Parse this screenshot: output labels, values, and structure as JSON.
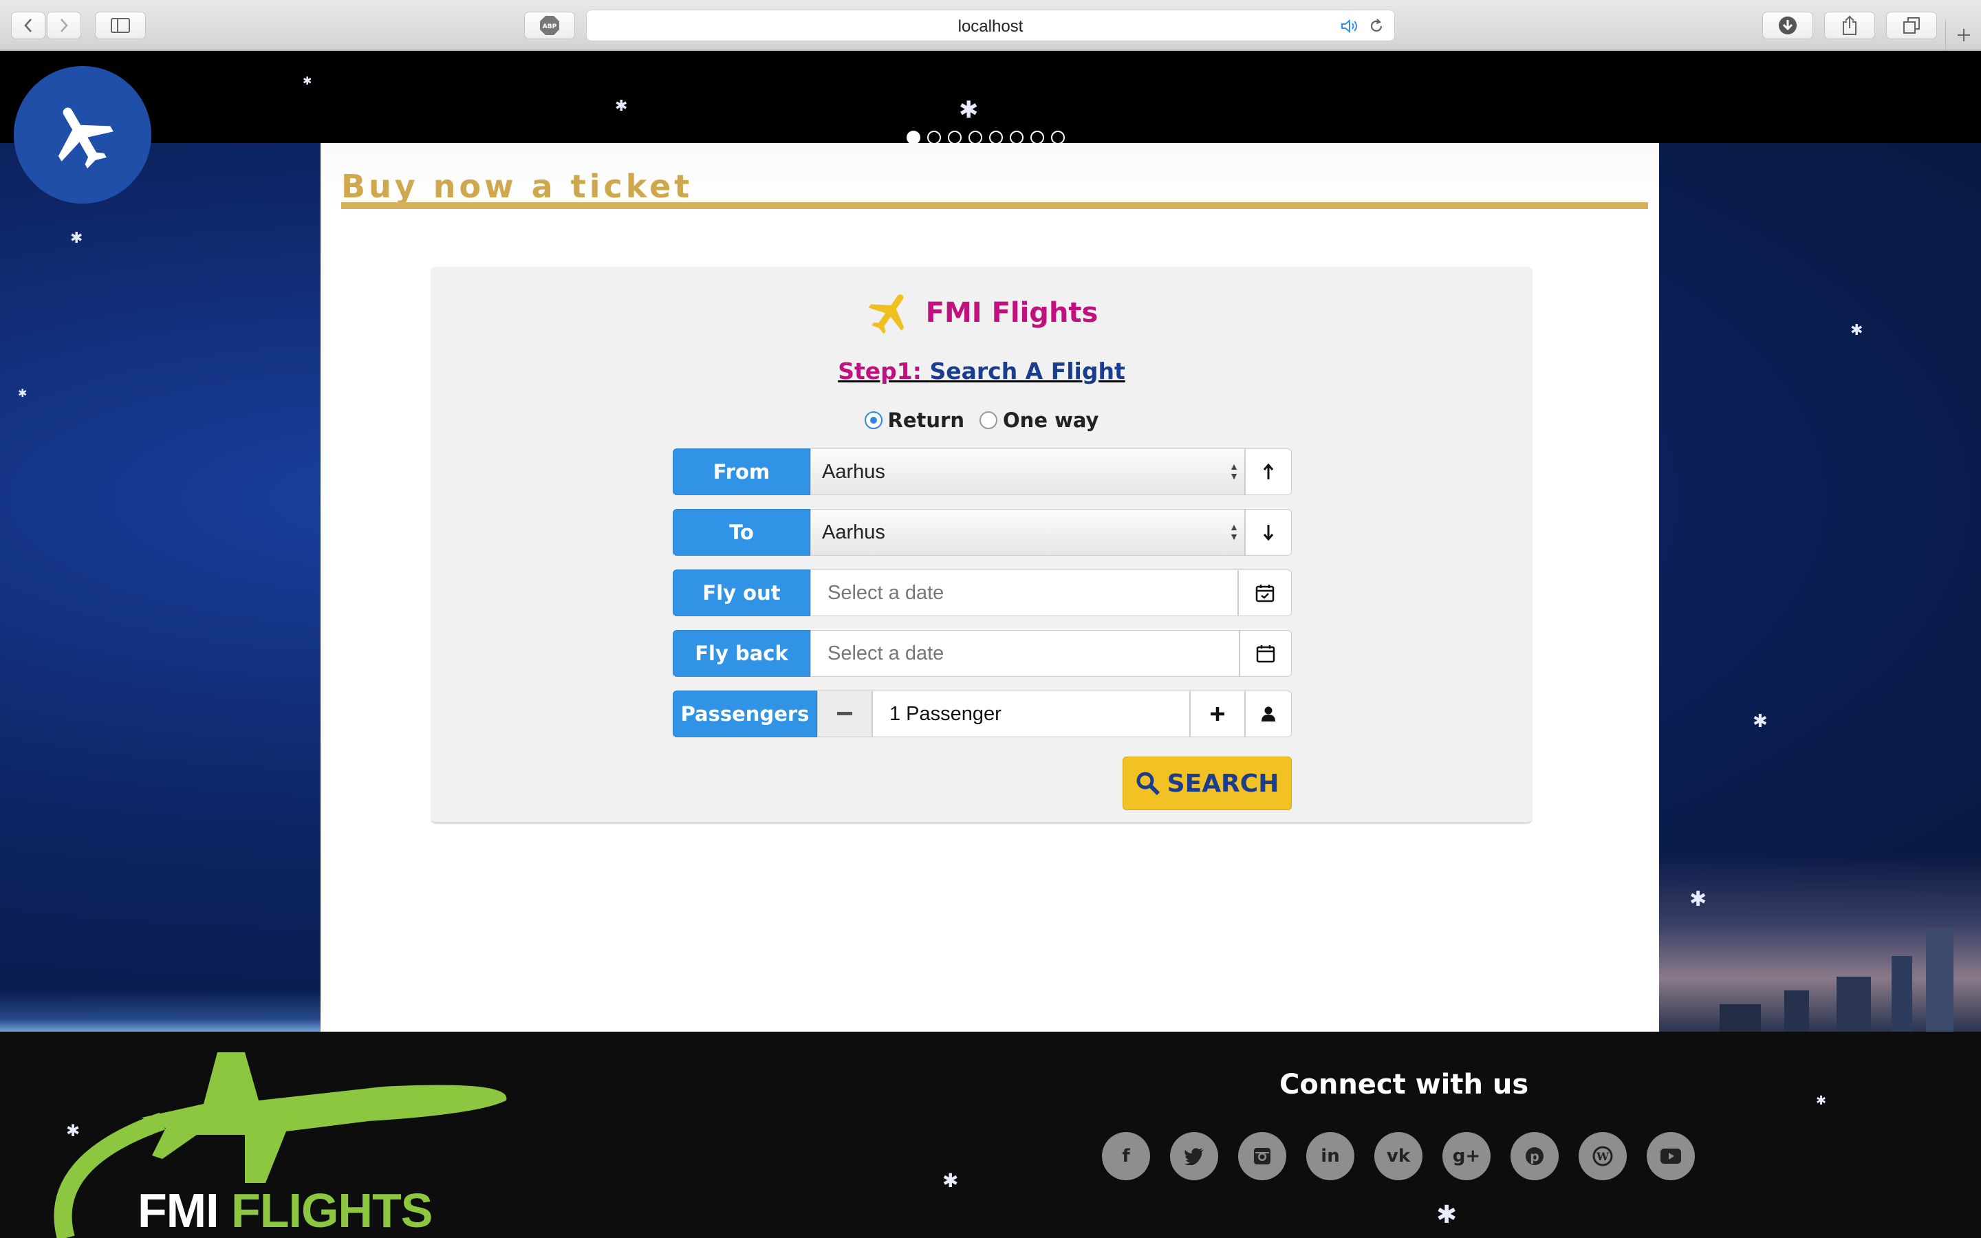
{
  "browser": {
    "url": "localhost"
  },
  "slider": {
    "dot_count": 8,
    "active_index": 0
  },
  "panel": {
    "title": "Buy now a ticket"
  },
  "form": {
    "brand_name": "FMI Flights",
    "step_prefix": "Step1:",
    "step_title": "Search A Flight",
    "trip_type": {
      "return_label": "Return",
      "oneway_label": "One way",
      "selected": "Return"
    },
    "from": {
      "label": "From",
      "value": "Aarhus"
    },
    "to": {
      "label": "To",
      "value": "Aarhus"
    },
    "fly_out": {
      "label": "Fly out",
      "placeholder": "Select a date"
    },
    "fly_back": {
      "label": "Fly back",
      "placeholder": "Select a date"
    },
    "passengers": {
      "label": "Passengers",
      "value": "1 Passenger"
    },
    "search_label": "SEARCH"
  },
  "footer": {
    "brand_part1": "FMI",
    "brand_part2": "FLIGHTS",
    "connect_title": "Connect with us",
    "social_icons": [
      "facebook-icon",
      "twitter-icon",
      "instagram-icon",
      "linkedin-icon",
      "vk-icon",
      "google-plus-icon",
      "pinterest-icon",
      "wordpress-icon",
      "youtube-icon"
    ]
  },
  "colors": {
    "accent_blue": "#3093e6",
    "brand_magenta": "#c0127e",
    "title_gold": "#cfa84e",
    "search_yellow": "#f2c124",
    "footer_green": "#8dc63f"
  }
}
